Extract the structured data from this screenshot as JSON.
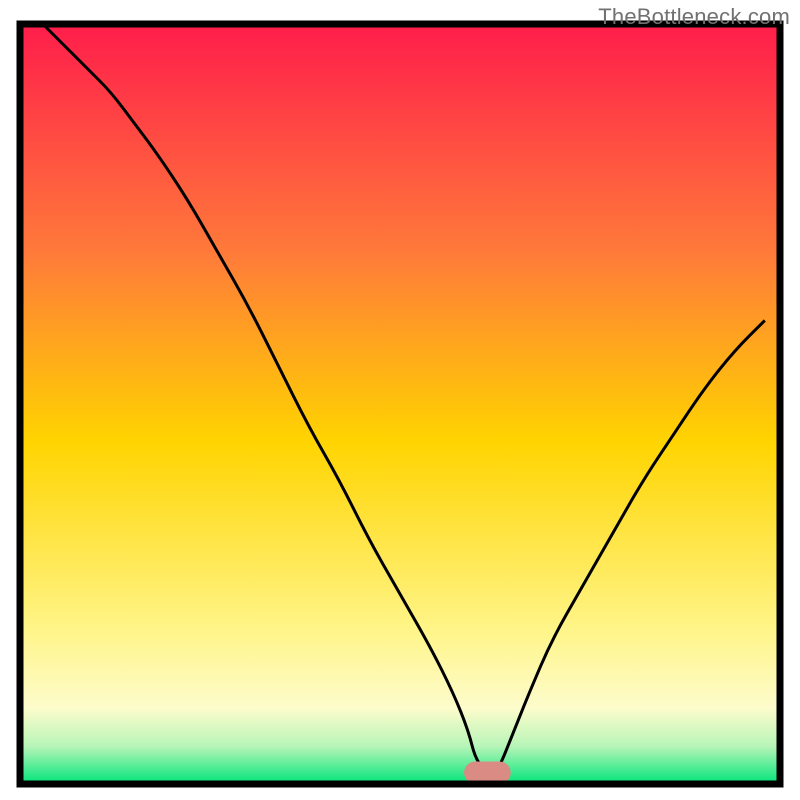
{
  "attribution": "TheBottleneck.com",
  "colors": {
    "frame": "#000000",
    "curve": "#000000",
    "marker_fill": "#d98b84",
    "marker_stroke": "#d98b84",
    "gradient_top": "#ff1d4b",
    "gradient_mid_upper": "#ff7a3a",
    "gradient_mid": "#ffd400",
    "gradient_mid_lower": "#fff58a",
    "gradient_low": "#fdfccc",
    "gradient_green_light": "#b8f5b8",
    "gradient_green": "#00e57a"
  },
  "chart_data": {
    "type": "line",
    "title": "",
    "xlabel": "",
    "ylabel": "",
    "xlim": [
      0,
      100
    ],
    "ylim": [
      0,
      100
    ],
    "grid": false,
    "legend": false,
    "note": "Axis units are percent of plot area; values are pixel-estimated from the figure, rounded to integers.",
    "series": [
      {
        "name": "bottleneck-curve",
        "x": [
          3,
          6,
          9,
          12,
          15,
          18,
          22,
          26,
          30,
          34,
          38,
          42,
          46,
          50,
          54,
          57,
          59,
          60,
          62,
          63,
          65,
          67,
          70,
          74,
          78,
          82,
          86,
          90,
          94,
          98
        ],
        "y": [
          100,
          97,
          94,
          91,
          87,
          83,
          77,
          70,
          63,
          55,
          47,
          40,
          32,
          25,
          18,
          12,
          7,
          3,
          1,
          2,
          7,
          12,
          19,
          26,
          33,
          40,
          46,
          52,
          57,
          61
        ]
      }
    ],
    "marker": {
      "x": 61.5,
      "y": 1.5,
      "rx": 3,
      "ry": 1.4
    },
    "background_gradient_stops": [
      {
        "offset": 0.0,
        "color_key": "gradient_top"
      },
      {
        "offset": 0.3,
        "color_key": "gradient_mid_upper"
      },
      {
        "offset": 0.55,
        "color_key": "gradient_mid"
      },
      {
        "offset": 0.8,
        "color_key": "gradient_mid_lower"
      },
      {
        "offset": 0.9,
        "color_key": "gradient_low"
      },
      {
        "offset": 0.95,
        "color_key": "gradient_green_light"
      },
      {
        "offset": 1.0,
        "color_key": "gradient_green"
      }
    ]
  }
}
